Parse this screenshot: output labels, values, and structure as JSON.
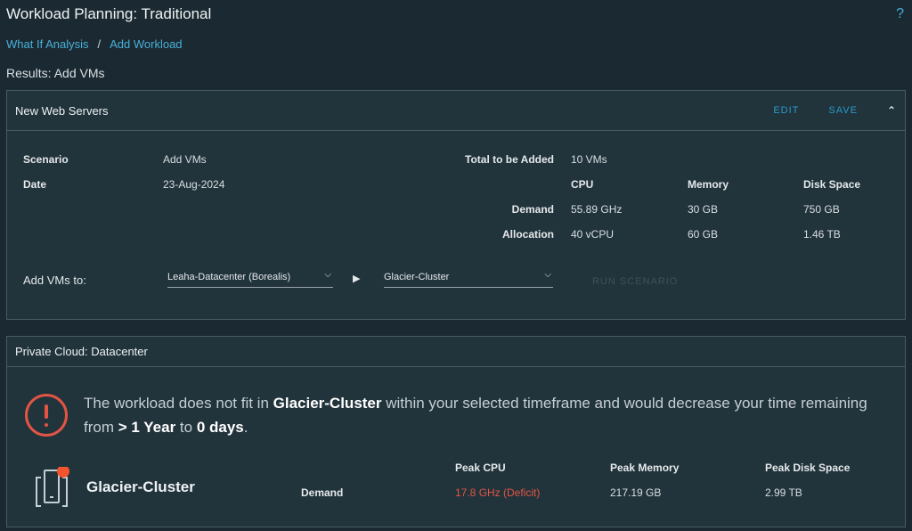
{
  "header": {
    "title": "Workload Planning: Traditional",
    "help_icon": "?",
    "breadcrumb": {
      "item1": "What If Analysis",
      "separator": "/",
      "item2": "Add Workload"
    },
    "results_title": "Results: Add VMs"
  },
  "scenario_card": {
    "title": "New Web Servers",
    "edit_label": "EDIT",
    "save_label": "SAVE",
    "collapse_icon": "⌃",
    "scenario_label": "Scenario",
    "scenario_value": "Add VMs",
    "date_label": "Date",
    "date_value": "23-Aug-2024",
    "total_label": "Total to be Added",
    "total_value": "10 VMs",
    "columns": {
      "cpu": "CPU",
      "memory": "Memory",
      "disk": "Disk Space"
    },
    "demand": {
      "label": "Demand",
      "cpu": "55.89 GHz",
      "memory": "30 GB",
      "disk": "750 GB"
    },
    "allocation": {
      "label": "Allocation",
      "cpu": "40 vCPU",
      "memory": "60 GB",
      "disk": "1.46 TB"
    },
    "add_vms_label": "Add VMs to:",
    "datacenter_select": "Leaha-Datacenter (Borealis)",
    "cluster_select": "Glacier-Cluster",
    "run_label": "RUN SCENARIO"
  },
  "result_card": {
    "title": "Private Cloud: Datacenter",
    "alert": {
      "t1": "The workload does not fit in ",
      "cluster": "Glacier-Cluster",
      "t2": " within your selected timeframe and would decrease your time remaining from ",
      "from": "> 1 Year",
      "t3": " to ",
      "to": "0 days",
      "t4": "."
    },
    "cluster_name": "Glacier-Cluster",
    "columns": {
      "cpu": "Peak CPU",
      "memory": "Peak Memory",
      "disk": "Peak Disk Space"
    },
    "demand": {
      "label": "Demand",
      "cpu": "17.8 GHz (Deficit)",
      "memory": "217.19 GB",
      "disk": "2.99 TB"
    }
  },
  "colors": {
    "background": "#1b2a32",
    "card": "#21333b",
    "link": "#49afd9",
    "danger": "#e25544",
    "status_dot": "#f2542d"
  }
}
